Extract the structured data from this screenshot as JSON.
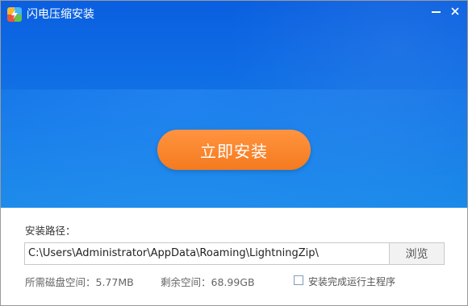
{
  "window": {
    "title": "闪电压缩安装",
    "app_icon": "lightning-zip-icon",
    "minimize_icon": "minimize-icon",
    "close_icon": "close-icon"
  },
  "banner": {
    "install_label": "立即安装",
    "colors": {
      "top": "#0a5fe0",
      "bottom": "#1b8ae9",
      "button": "#f57a1f"
    }
  },
  "install_options": {
    "path_label": "安装路径：",
    "path_value": "C:\\Users\\Administrator\\AppData\\Roaming\\LightningZip\\",
    "browse_label": "浏览",
    "required_space": "所需磁盘空间：5.77MB",
    "remaining_space": "剩余空间：68.99GB",
    "run_after_install_label": "安装完成运行主程序",
    "run_after_install_checked": false
  }
}
